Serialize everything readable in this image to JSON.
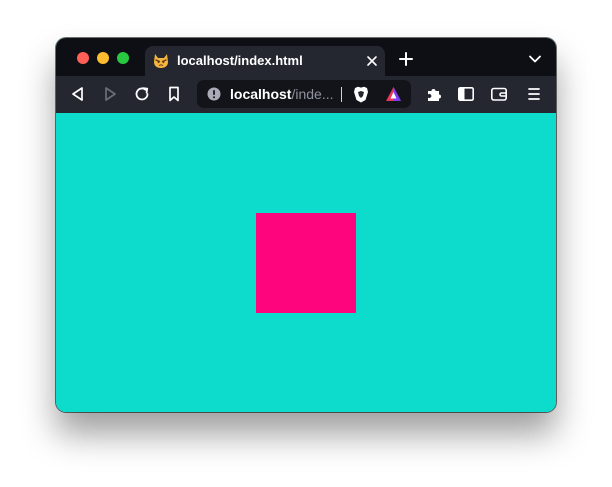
{
  "window": {
    "traffic_lights": {
      "close_color": "#fe5f57",
      "minimize_color": "#febc2e",
      "maximize_color": "#28c840"
    }
  },
  "tab": {
    "title": "localhost/index.html",
    "favicon": "cat-face-icon",
    "close_icon": "close-icon"
  },
  "tabbar": {
    "new_tab_icon": "plus-icon",
    "tabs_menu_icon": "chevron-down-icon"
  },
  "toolbar": {
    "back_icon": "back-arrow-icon",
    "forward_icon": "forward-arrow-icon",
    "reload_icon": "reload-icon",
    "bookmark_icon": "bookmark-icon",
    "extensions_icon": "puzzle-icon",
    "sidebar_icon": "sidebar-icon",
    "wallet_icon": "wallet-icon",
    "menu_icon": "hamburger-menu-icon"
  },
  "urlbar": {
    "host": "localhost",
    "rest": "/inde...",
    "site_info_icon": "info-icon",
    "shields_icon": "brave-shield-icon",
    "rewards_icon": "brave-rewards-icon"
  },
  "page": {
    "background_color": "#0ddbcb",
    "square_color": "#ff057d"
  }
}
